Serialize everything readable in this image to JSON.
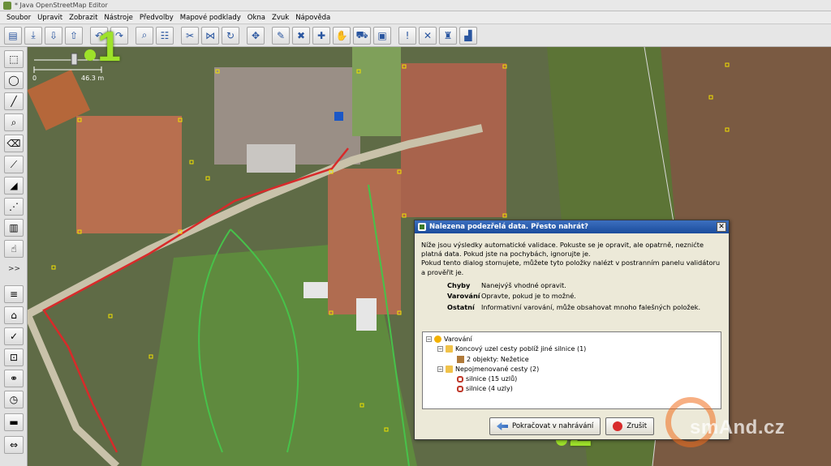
{
  "window": {
    "title": "* Java OpenStreetMap Editor"
  },
  "menu": [
    "Soubor",
    "Upravit",
    "Zobrazit",
    "Nástroje",
    "Předvolby",
    "Mapové podklady",
    "Okna",
    "Zvuk",
    "Nápověda"
  ],
  "toolbar": {
    "buttons": [
      "open-icon",
      "download-icon",
      "download-more-icon",
      "upload-icon",
      "undo-icon",
      "redo-icon",
      "zoom-data-icon",
      "preferences-icon",
      "split-way-icon",
      "combine-icon",
      "refresh-icon",
      "select-all-icon",
      "draw-icon",
      "delete-icon",
      "marker-icon",
      "hand-icon",
      "car-icon",
      "bus-icon",
      "warning-icon",
      "cross-icon",
      "building-icon",
      "factory-icon"
    ]
  },
  "sidebar": {
    "buttons": [
      "select-icon",
      "lasso-icon",
      "draw-line-icon",
      "zoom-icon",
      "delete-icon",
      "improve-way-icon",
      "parallel-icon",
      "align-icon",
      "building-tool-icon",
      "hand-tool-icon"
    ],
    "more_label": ">>",
    "panels": [
      "layers-icon",
      "tags-icon",
      "validator-icon",
      "selection-icon",
      "relations-icon",
      "history-icon",
      "map-paint-icon",
      "filter-icon"
    ]
  },
  "scale": {
    "zero": "0",
    "value": "46.3 m"
  },
  "markers": {
    "one": "1",
    "two": "2"
  },
  "dialog": {
    "title": "Nalezena podezřelá data. Přesto nahrát?",
    "close_label": "✕",
    "para1": "Níže jsou výsledky automatické validace. Pokuste se je opravit, ale opatrně, neznićte platná data. Pokud jste na pochybách, ignorujte je.",
    "para2": "Pokud tento dialog stornujete, můžete tyto položky nalézt v postranním panelu validátoru a prověřit je.",
    "legend": [
      {
        "key": "Chyby",
        "text": "Nanejvýš vhodné opravit."
      },
      {
        "key": "Varování",
        "text": "Opravte, pokud je to možné."
      },
      {
        "key": "Ostatní",
        "text": "Informativní varování, může obsahovat mnoho falešných položek."
      }
    ],
    "tree": [
      {
        "label": "Varování",
        "depth": 0,
        "icon": "warn",
        "exp": "−"
      },
      {
        "label": "Koncový uzel cesty poblíž jiné silnice (1)",
        "depth": 1,
        "icon": "folder",
        "exp": "−"
      },
      {
        "label": "2 objekty: Nežetice",
        "depth": 2,
        "icon": "obj",
        "exp": ""
      },
      {
        "label": "Nepojmenované cesty (2)",
        "depth": 1,
        "icon": "folder",
        "exp": "−"
      },
      {
        "label": "silnice (15 uzlů)",
        "depth": 2,
        "icon": "way",
        "exp": ""
      },
      {
        "label": "silnice (4 uzly)",
        "depth": 2,
        "icon": "way",
        "exp": ""
      }
    ],
    "buttons": {
      "continue": "Pokračovat v nahrávání",
      "cancel": "Zrušit"
    }
  },
  "watermark": {
    "text": "smAnd.cz"
  }
}
